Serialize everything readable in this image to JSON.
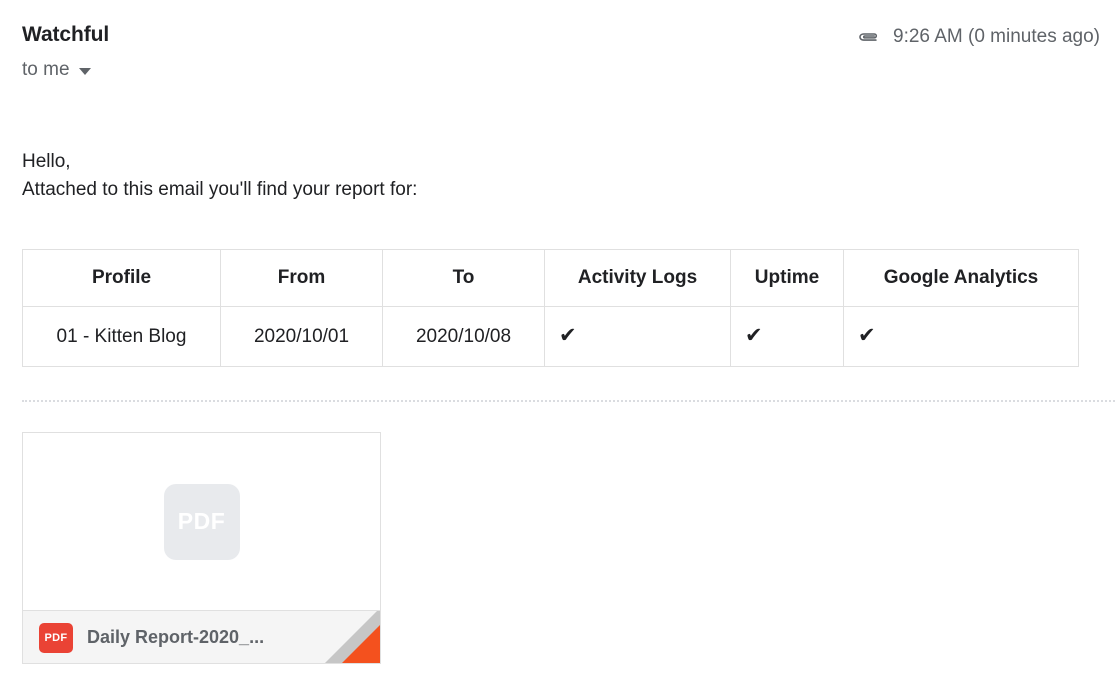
{
  "header": {
    "sender": "Watchful",
    "recipient": "to me",
    "timestamp": "9:26 AM (0 minutes ago)",
    "attachment_icon": "paperclip-icon",
    "caret_icon": "chevron-down-icon"
  },
  "body": {
    "greeting": "Hello,",
    "intro": "Attached to this email you'll find your report for:"
  },
  "table": {
    "headers": [
      "Profile",
      "From",
      "To",
      "Activity Logs",
      "Uptime",
      "Google Analytics"
    ],
    "rows": [
      {
        "profile": "01 - Kitten Blog",
        "from": "2020/10/01",
        "to": "2020/10/08",
        "activity_logs": "✔",
        "uptime": "✔",
        "google_analytics": "✔"
      }
    ]
  },
  "attachment": {
    "placeholder_label": "PDF",
    "badge_label": "PDF",
    "filename": "Daily Report-2020_...",
    "file_type": "pdf"
  },
  "colors": {
    "text_primary": "#202124",
    "text_secondary": "#5f6368",
    "border": "#e0e0e0",
    "pdf_red": "#ea4335",
    "fold_red": "#f4511e",
    "fold_gray": "#c6c6c6",
    "footer_bg": "#f5f5f5"
  }
}
